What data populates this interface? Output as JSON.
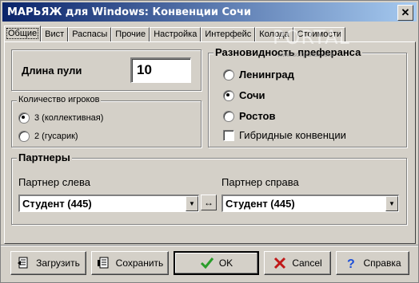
{
  "window": {
    "title": "МАРЬЯЖ для Windows: Конвенции Сочи",
    "close_glyph": "✕"
  },
  "tabs": [
    {
      "label": "Общие",
      "active": true
    },
    {
      "label": "Вист"
    },
    {
      "label": "Распасы"
    },
    {
      "label": "Прочие"
    },
    {
      "label": "Настройка"
    },
    {
      "label": "Интерфейс"
    },
    {
      "label": "Колода"
    },
    {
      "label": "Стоимости"
    }
  ],
  "watermark": {
    "text": "PORTAL",
    "sub": "www.softportal.com"
  },
  "bullet": {
    "label": "Длина пули",
    "value": "10"
  },
  "players": {
    "title": "Количество игроков",
    "options": [
      {
        "label": "3 (коллективная)",
        "selected": true
      },
      {
        "label": "2 (гусарик)",
        "selected": false
      }
    ]
  },
  "preference": {
    "title": "Разновидность преферанса",
    "options": [
      {
        "label": "Ленинград",
        "selected": false
      },
      {
        "label": "Сочи",
        "selected": true
      },
      {
        "label": "Ростов",
        "selected": false
      }
    ],
    "hybrid_label": "Гибридные конвенции",
    "hybrid_checked": false
  },
  "partners": {
    "title": "Партнеры",
    "left_label": "Партнер слева",
    "left_value": "Студент (445)",
    "right_label": "Партнер справа",
    "right_value": "Студент (445)",
    "swap_glyph": "↔",
    "dropdown_glyph": "▼"
  },
  "buttons": {
    "load": "Загрузить",
    "save": "Сохранить",
    "ok": "OK",
    "cancel": "Cancel",
    "help": "Справка"
  },
  "colors": {
    "title_start": "#0a246a",
    "title_end": "#a6caf0",
    "face": "#d4d0c8",
    "ok_check": "#2a9d2a",
    "cancel_x": "#c01818",
    "help_q": "#1d4fd8"
  }
}
